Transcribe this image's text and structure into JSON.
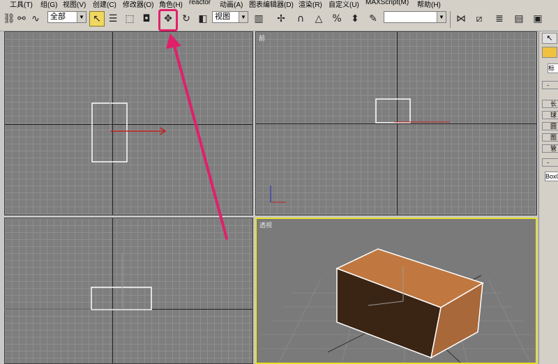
{
  "menu": {
    "items": [
      "工具(T)",
      "组(G)",
      "视图(V)",
      "创建(C)",
      "修改器(O)",
      "角色(H)",
      "reactor",
      "动画(A)",
      "图表编辑器(D)",
      "渲染(R)",
      "自定义(U)",
      "MAXScript(M)",
      "帮助(H)"
    ]
  },
  "toolbar": {
    "selection_filter": "全部",
    "coord_system": "视图",
    "named_selection": "",
    "icons": [
      "link-icon",
      "unlink-icon",
      "bind-spacewarp-icon",
      "select-object-icon",
      "select-by-name-icon",
      "rect-region-icon",
      "window-crossing-icon",
      "select-move-icon",
      "select-rotate-icon",
      "select-scale-icon",
      "pivot-icon",
      "manipulate-icon",
      "snap-3d-icon",
      "angle-snap-icon",
      "percent-snap-icon",
      "spinner-snap-icon",
      "edit-named-sets-icon",
      "mirror-icon",
      "align-icon",
      "layer-manager-icon",
      "curve-editor-icon",
      "render-setup-icon"
    ]
  },
  "viewports": {
    "front_label": "前",
    "perspective_label": "透视"
  },
  "command_panel": {
    "dropdown_value": "标",
    "rollout1_header": "-",
    "buttons": [
      "长",
      "球",
      "圆",
      "图",
      "管"
    ],
    "rollout2_header": "-",
    "name_field": "Box0"
  },
  "colors": {
    "active_border": "#e8e020",
    "annotation": "#e0206a",
    "box_top": "#c07840",
    "box_front": "#3a2414",
    "box_side": "#a8683a",
    "gizmo_x": "#c02020",
    "gizmo_y": "#20a020",
    "gizmo_z": "#2020c0"
  }
}
